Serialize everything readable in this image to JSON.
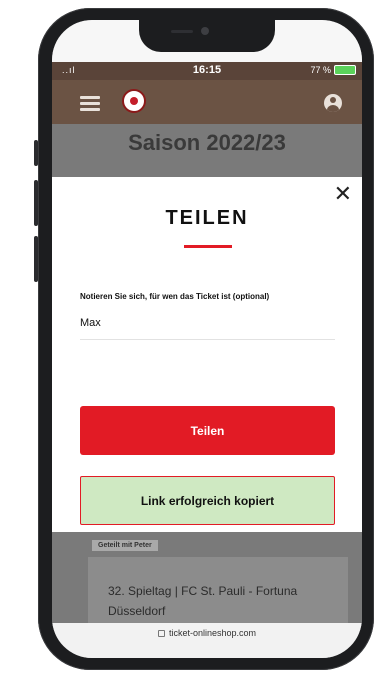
{
  "status_bar": {
    "signal": "..ıl",
    "time": "16:15",
    "battery": "77 %"
  },
  "nav": {
    "menu_icon": "hamburger-icon",
    "logo_icon": "club-crest-logo",
    "account_icon": "user-account-icon"
  },
  "background": {
    "season_title": "Saison 2022/23",
    "shared_badge": "Geteilt mit Peter",
    "match_title": "32. Spieltag | FC St. Pauli - Fortuna Düsseldorf"
  },
  "modal": {
    "close_icon": "close-icon",
    "title": "TEILEN",
    "field_label": "Notieren Sie sich, für wen das Ticket ist (optional)",
    "field_value": "Max",
    "share_button": "Teilen",
    "copied_message": "Link erfolgreich kopiert"
  },
  "browser": {
    "url": "ticket-onlineshop.com"
  },
  "colors": {
    "accent_red": "#e21b25",
    "nav_brown": "#6b5344",
    "success_green": "#cfe9c2"
  }
}
